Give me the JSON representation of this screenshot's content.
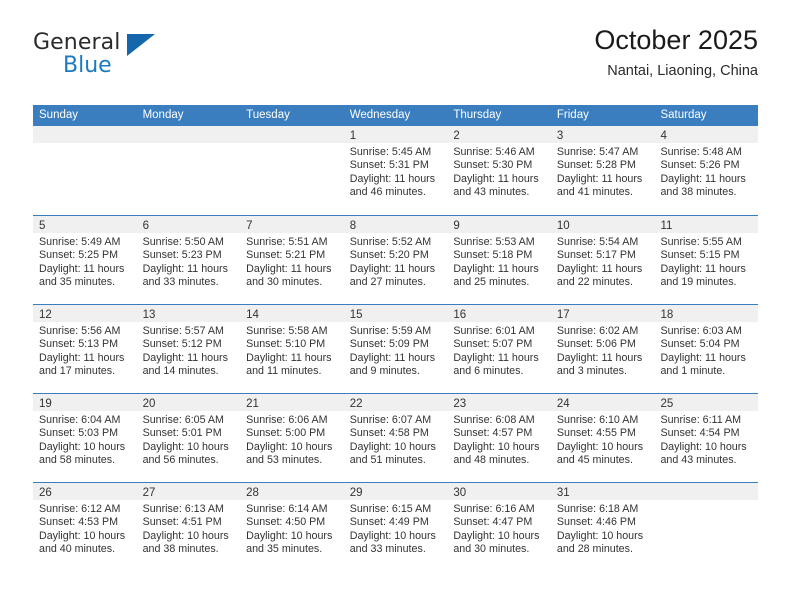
{
  "brand": {
    "name_top": "General",
    "name_bottom": "Blue"
  },
  "header": {
    "title": "October 2025",
    "subtitle": "Nantai, Liaoning, China"
  },
  "weekdays": [
    "Sunday",
    "Monday",
    "Tuesday",
    "Wednesday",
    "Thursday",
    "Friday",
    "Saturday"
  ],
  "labels": {
    "sunrise": "Sunrise:",
    "sunset": "Sunset:",
    "daylight": "Daylight:"
  },
  "colors": {
    "header_bar": "#3a7ebf",
    "accent_blue": "#1c7ac0",
    "daynum_band": "#f0f0f0",
    "text": "#333333"
  },
  "weeks": [
    [
      {
        "day": "",
        "empty": true
      },
      {
        "day": "",
        "empty": true
      },
      {
        "day": "",
        "empty": true
      },
      {
        "day": "1",
        "sunrise": "Sunrise: 5:45 AM",
        "sunset": "Sunset: 5:31 PM",
        "daylight": "Daylight: 11 hours and 46 minutes."
      },
      {
        "day": "2",
        "sunrise": "Sunrise: 5:46 AM",
        "sunset": "Sunset: 5:30 PM",
        "daylight": "Daylight: 11 hours and 43 minutes."
      },
      {
        "day": "3",
        "sunrise": "Sunrise: 5:47 AM",
        "sunset": "Sunset: 5:28 PM",
        "daylight": "Daylight: 11 hours and 41 minutes."
      },
      {
        "day": "4",
        "sunrise": "Sunrise: 5:48 AM",
        "sunset": "Sunset: 5:26 PM",
        "daylight": "Daylight: 11 hours and 38 minutes."
      }
    ],
    [
      {
        "day": "5",
        "sunrise": "Sunrise: 5:49 AM",
        "sunset": "Sunset: 5:25 PM",
        "daylight": "Daylight: 11 hours and 35 minutes."
      },
      {
        "day": "6",
        "sunrise": "Sunrise: 5:50 AM",
        "sunset": "Sunset: 5:23 PM",
        "daylight": "Daylight: 11 hours and 33 minutes."
      },
      {
        "day": "7",
        "sunrise": "Sunrise: 5:51 AM",
        "sunset": "Sunset: 5:21 PM",
        "daylight": "Daylight: 11 hours and 30 minutes."
      },
      {
        "day": "8",
        "sunrise": "Sunrise: 5:52 AM",
        "sunset": "Sunset: 5:20 PM",
        "daylight": "Daylight: 11 hours and 27 minutes."
      },
      {
        "day": "9",
        "sunrise": "Sunrise: 5:53 AM",
        "sunset": "Sunset: 5:18 PM",
        "daylight": "Daylight: 11 hours and 25 minutes."
      },
      {
        "day": "10",
        "sunrise": "Sunrise: 5:54 AM",
        "sunset": "Sunset: 5:17 PM",
        "daylight": "Daylight: 11 hours and 22 minutes."
      },
      {
        "day": "11",
        "sunrise": "Sunrise: 5:55 AM",
        "sunset": "Sunset: 5:15 PM",
        "daylight": "Daylight: 11 hours and 19 minutes."
      }
    ],
    [
      {
        "day": "12",
        "sunrise": "Sunrise: 5:56 AM",
        "sunset": "Sunset: 5:13 PM",
        "daylight": "Daylight: 11 hours and 17 minutes."
      },
      {
        "day": "13",
        "sunrise": "Sunrise: 5:57 AM",
        "sunset": "Sunset: 5:12 PM",
        "daylight": "Daylight: 11 hours and 14 minutes."
      },
      {
        "day": "14",
        "sunrise": "Sunrise: 5:58 AM",
        "sunset": "Sunset: 5:10 PM",
        "daylight": "Daylight: 11 hours and 11 minutes."
      },
      {
        "day": "15",
        "sunrise": "Sunrise: 5:59 AM",
        "sunset": "Sunset: 5:09 PM",
        "daylight": "Daylight: 11 hours and 9 minutes."
      },
      {
        "day": "16",
        "sunrise": "Sunrise: 6:01 AM",
        "sunset": "Sunset: 5:07 PM",
        "daylight": "Daylight: 11 hours and 6 minutes."
      },
      {
        "day": "17",
        "sunrise": "Sunrise: 6:02 AM",
        "sunset": "Sunset: 5:06 PM",
        "daylight": "Daylight: 11 hours and 3 minutes."
      },
      {
        "day": "18",
        "sunrise": "Sunrise: 6:03 AM",
        "sunset": "Sunset: 5:04 PM",
        "daylight": "Daylight: 11 hours and 1 minute."
      }
    ],
    [
      {
        "day": "19",
        "sunrise": "Sunrise: 6:04 AM",
        "sunset": "Sunset: 5:03 PM",
        "daylight": "Daylight: 10 hours and 58 minutes."
      },
      {
        "day": "20",
        "sunrise": "Sunrise: 6:05 AM",
        "sunset": "Sunset: 5:01 PM",
        "daylight": "Daylight: 10 hours and 56 minutes."
      },
      {
        "day": "21",
        "sunrise": "Sunrise: 6:06 AM",
        "sunset": "Sunset: 5:00 PM",
        "daylight": "Daylight: 10 hours and 53 minutes."
      },
      {
        "day": "22",
        "sunrise": "Sunrise: 6:07 AM",
        "sunset": "Sunset: 4:58 PM",
        "daylight": "Daylight: 10 hours and 51 minutes."
      },
      {
        "day": "23",
        "sunrise": "Sunrise: 6:08 AM",
        "sunset": "Sunset: 4:57 PM",
        "daylight": "Daylight: 10 hours and 48 minutes."
      },
      {
        "day": "24",
        "sunrise": "Sunrise: 6:10 AM",
        "sunset": "Sunset: 4:55 PM",
        "daylight": "Daylight: 10 hours and 45 minutes."
      },
      {
        "day": "25",
        "sunrise": "Sunrise: 6:11 AM",
        "sunset": "Sunset: 4:54 PM",
        "daylight": "Daylight: 10 hours and 43 minutes."
      }
    ],
    [
      {
        "day": "26",
        "sunrise": "Sunrise: 6:12 AM",
        "sunset": "Sunset: 4:53 PM",
        "daylight": "Daylight: 10 hours and 40 minutes."
      },
      {
        "day": "27",
        "sunrise": "Sunrise: 6:13 AM",
        "sunset": "Sunset: 4:51 PM",
        "daylight": "Daylight: 10 hours and 38 minutes."
      },
      {
        "day": "28",
        "sunrise": "Sunrise: 6:14 AM",
        "sunset": "Sunset: 4:50 PM",
        "daylight": "Daylight: 10 hours and 35 minutes."
      },
      {
        "day": "29",
        "sunrise": "Sunrise: 6:15 AM",
        "sunset": "Sunset: 4:49 PM",
        "daylight": "Daylight: 10 hours and 33 minutes."
      },
      {
        "day": "30",
        "sunrise": "Sunrise: 6:16 AM",
        "sunset": "Sunset: 4:47 PM",
        "daylight": "Daylight: 10 hours and 30 minutes."
      },
      {
        "day": "31",
        "sunrise": "Sunrise: 6:18 AM",
        "sunset": "Sunset: 4:46 PM",
        "daylight": "Daylight: 10 hours and 28 minutes."
      },
      {
        "day": "",
        "empty": true
      }
    ]
  ]
}
